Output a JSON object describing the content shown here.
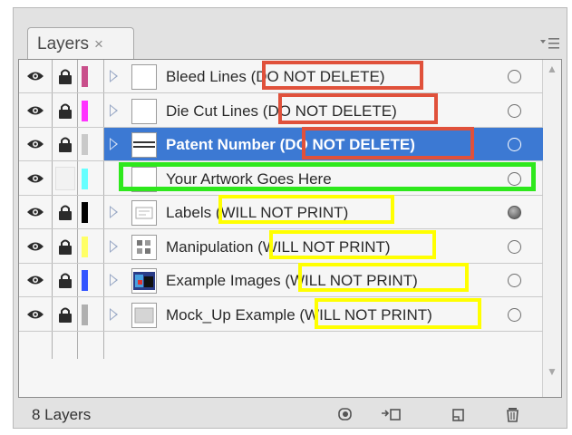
{
  "panel": {
    "tab_label": "Layers",
    "tab_close_glyph": "×",
    "menu_icon": "panel-menu-icon",
    "footer_count": "8 Layers",
    "footer_icons": [
      "make-clipping-mask-icon",
      "create-new-sublayer-icon",
      "create-new-layer-icon",
      "delete-layer-icon"
    ]
  },
  "layers": [
    {
      "name": "Bleed Lines",
      "note": "(DO NOT DELETE)",
      "color": "#c94f8b",
      "thumb": "blank",
      "locked": true,
      "expandable": true,
      "selected": false,
      "target_filled": false
    },
    {
      "name": "Die Cut Lines",
      "note": "(DO NOT DELETE)",
      "color": "#ff33ff",
      "thumb": "blank",
      "locked": true,
      "expandable": true,
      "selected": false,
      "target_filled": false
    },
    {
      "name": "Patent Number",
      "note": "(DO NOT DELETE)",
      "color": "#c9c9c9",
      "thumb": "lines",
      "locked": true,
      "expandable": true,
      "selected": true,
      "target_filled": false
    },
    {
      "name": "Your Artwork Goes Here",
      "note": "",
      "color": "#66ffff",
      "thumb": "blank",
      "locked": false,
      "expandable": false,
      "selected": false,
      "target_filled": false
    },
    {
      "name": "Labels",
      "note": "(WILL NOT PRINT)",
      "color": "#000000",
      "thumb": "label",
      "locked": true,
      "expandable": true,
      "selected": false,
      "target_filled": true
    },
    {
      "name": "Manipulation",
      "note": "(WILL NOT PRINT)",
      "color": "#ffff66",
      "thumb": "grid",
      "locked": true,
      "expandable": true,
      "selected": false,
      "target_filled": false
    },
    {
      "name": "Example Images",
      "note": "(WILL NOT PRINT)",
      "color": "#3355ff",
      "thumb": "image",
      "locked": true,
      "expandable": true,
      "selected": false,
      "target_filled": false
    },
    {
      "name": "Mock_Up Example",
      "note": "(WILL NOT PRINT)",
      "color": "#b0b0b0",
      "thumb": "gray",
      "locked": true,
      "expandable": true,
      "selected": false,
      "target_filled": false
    }
  ],
  "annotation_colors": {
    "do_not_delete": "#e0513b",
    "artwork": "#2ee81c",
    "will_not_print": "#ffff00"
  }
}
